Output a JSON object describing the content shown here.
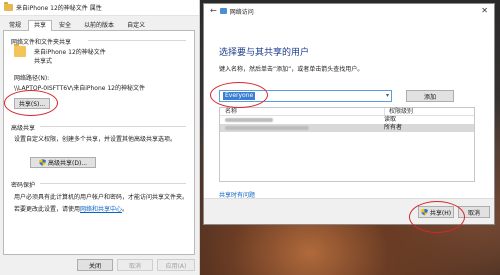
{
  "properties_dialog": {
    "title": "来自iPhone 12的神秘文件 属性",
    "tabs": [
      "常规",
      "共享",
      "安全",
      "以前的版本",
      "自定义"
    ],
    "active_tab": "共享",
    "network_share_section": "网络文件和文件夹共享",
    "folder_name": "来自iPhone 12的神秘文件",
    "folder_status": "共享式",
    "network_path_label": "网络路径(N):",
    "network_path_value": "\\\\LAPTOP-0ISFTT6V\\来自iPhone 12的神秘文件",
    "share_button": "共享(S)...",
    "advanced_section": "高级共享",
    "advanced_desc": "设置自定义权限，创建多个共享，并设置其他高级共享选项。",
    "advanced_button": "高级共享(D)...",
    "password_section": "密码保护",
    "password_desc": "用户必须具有此计算机的用户帐户和密码，才能访问共享文件夹。",
    "password_link_prefix": "若要更改此设置，请使用",
    "password_link": "网络和共享中心",
    "password_link_suffix": "。",
    "footer": {
      "close": "关闭",
      "cancel": "取消",
      "apply": "应用(A)"
    }
  },
  "share_dialog": {
    "title": "网络访问",
    "heading": "选择要与其共享的用户",
    "instruction": "键入名称，然后单击“添加”，或者单击箭头查找用户。",
    "combo_value": "Everyone",
    "add_button": "添加",
    "columns": [
      "名称",
      "权限级别"
    ],
    "rows": [
      {
        "permission": "读取"
      },
      {
        "permission": "所有者"
      }
    ],
    "trouble_link": "共享时有问题",
    "share_button": "共享(H)",
    "cancel_button": "取消"
  },
  "colors": {
    "annotation": "#d8262e",
    "selection": "#3b7fd3",
    "heading": "#1c3d8c",
    "link": "#0b63c5"
  }
}
